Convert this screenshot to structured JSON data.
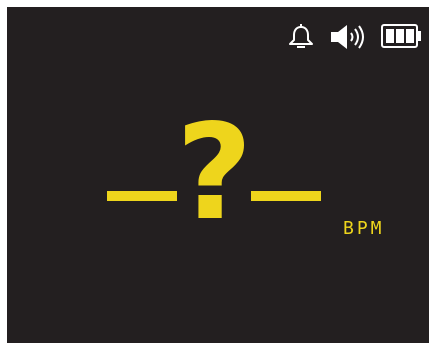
{
  "colors": {
    "background": "#231f20",
    "accent": "#eed51c",
    "icon": "#ffffff"
  },
  "status_bar": {
    "icons": [
      "bell-icon",
      "speaker-icon",
      "battery-icon"
    ],
    "battery_level": 1.0
  },
  "reading": {
    "value": "?",
    "unit": "BPM"
  }
}
